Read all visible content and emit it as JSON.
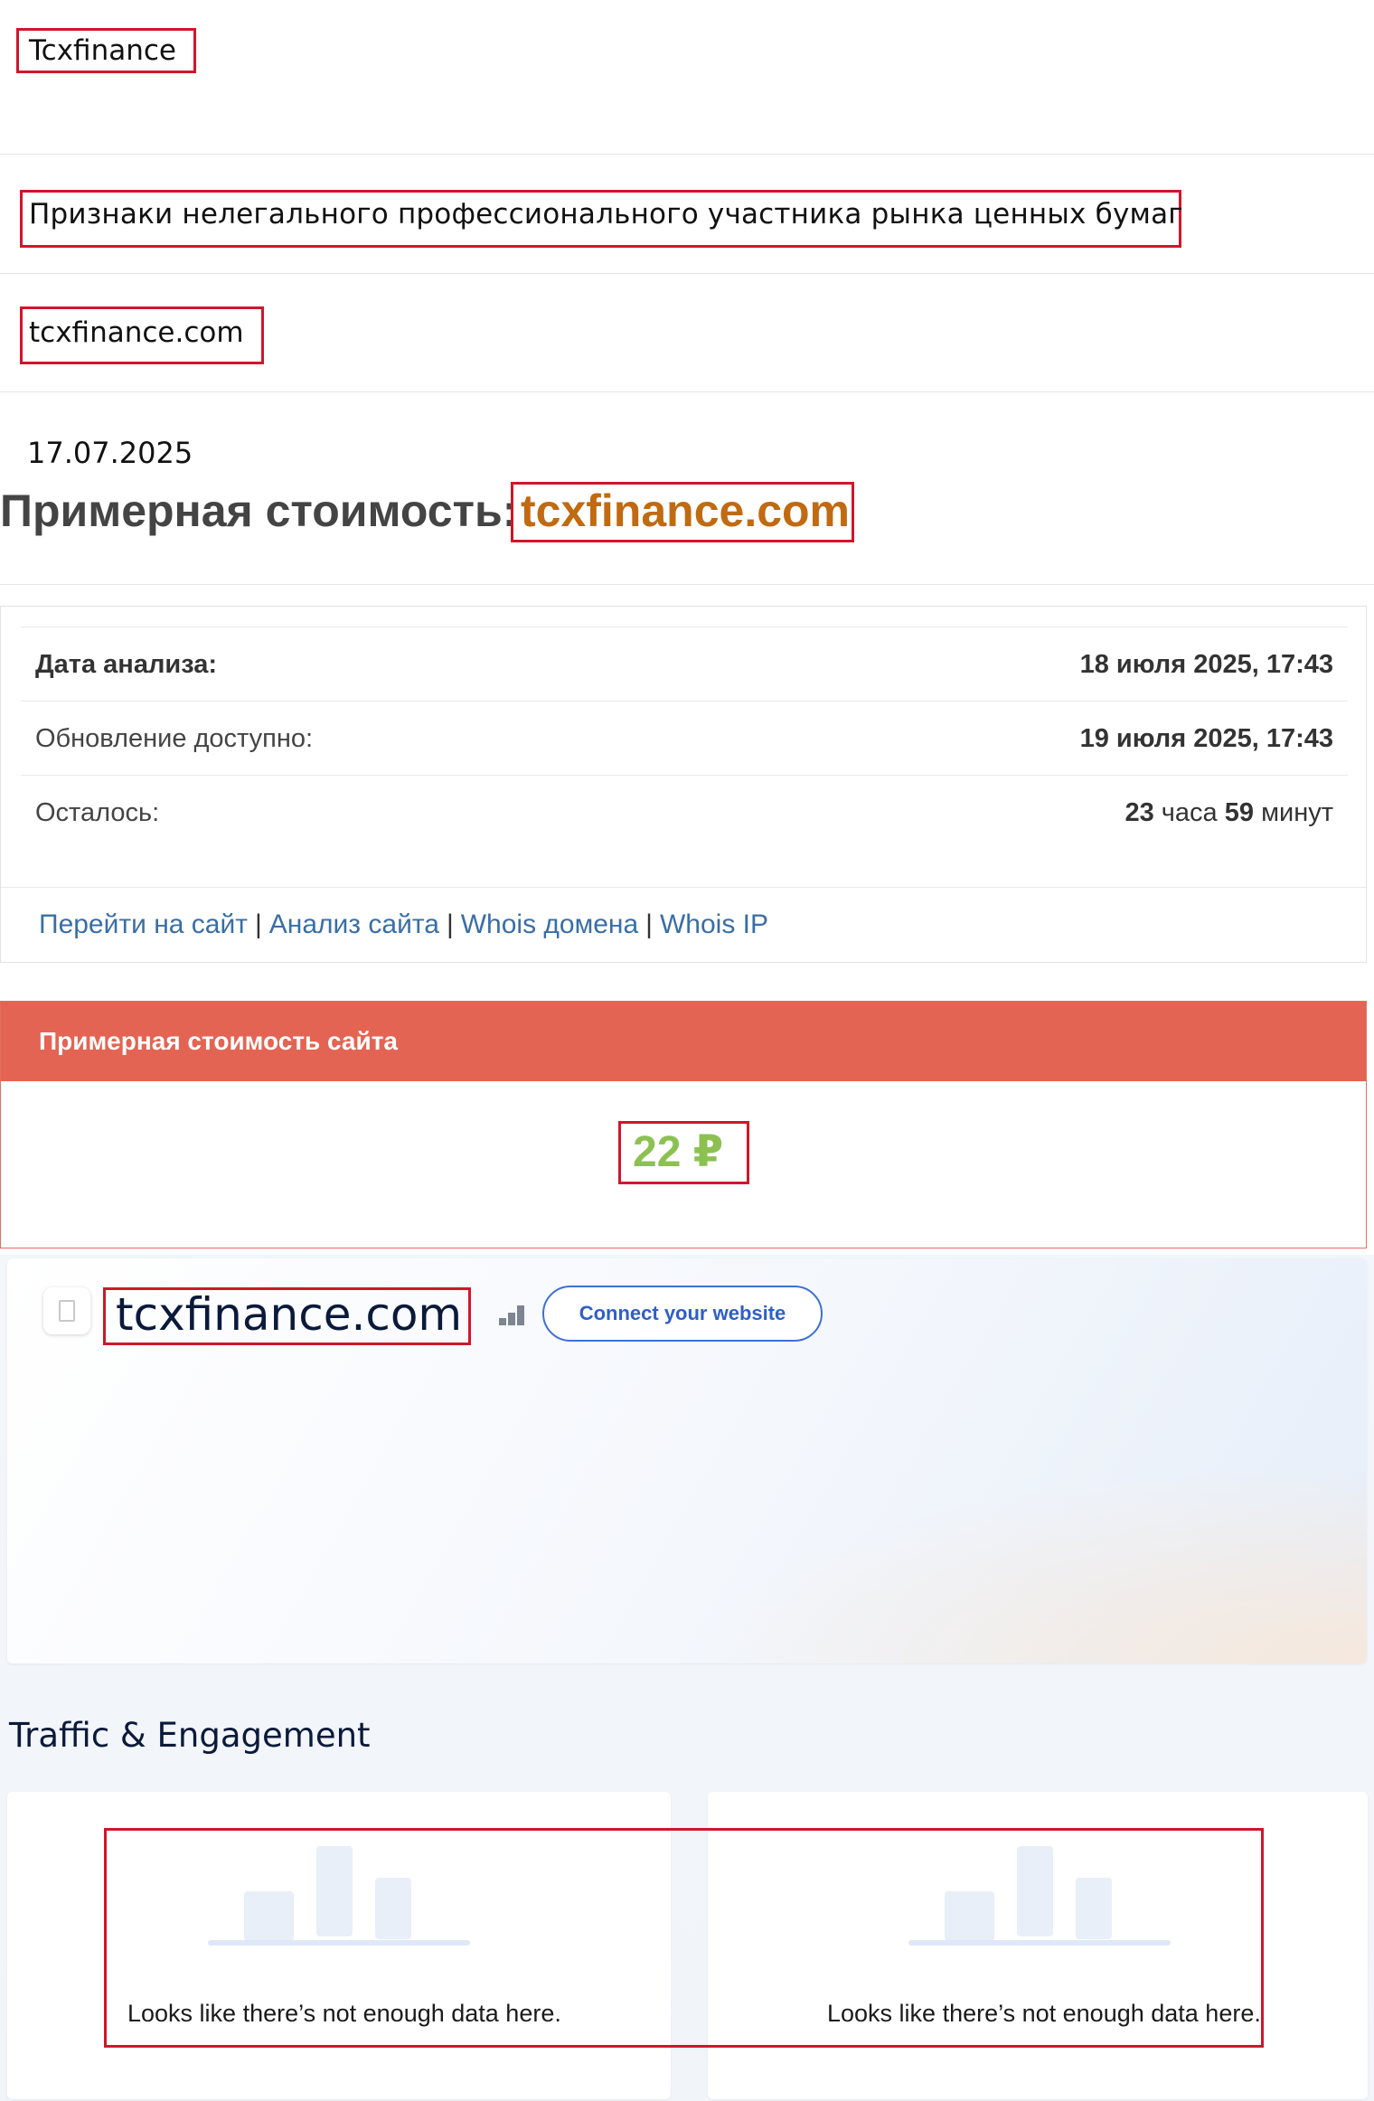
{
  "page": {
    "title": "Tcxfinance",
    "category": "Признаки нелегального профессионального участника рынка ценных бумаг",
    "domain": "tcxfinance.com",
    "date": "17.07.2025"
  },
  "cost_section": {
    "heading": "Примерная стоимость:",
    "domain": "tcxfinance.com"
  },
  "analysis": {
    "rows": [
      {
        "label": "Дата анализа:",
        "value": "18 июля 2025, 17:43"
      },
      {
        "label": "Обновление доступно:",
        "value": "19 июля 2025, 17:43"
      }
    ],
    "remaining_label": "Осталось:",
    "remaining": {
      "hours": "23",
      "hours_unit": "часа",
      "minutes": "59",
      "minutes_unit": "минут"
    },
    "links": [
      "Перейти на сайт",
      "Анализ сайта",
      "Whois домена",
      "Whois IP"
    ]
  },
  "price_card": {
    "header": "Примерная стоимость сайта",
    "value": "22 ₽"
  },
  "similarweb": {
    "domain": "tcxfinance.com",
    "connect_button": "Connect your website",
    "traffic_title": "Traffic & Engagement",
    "empty_messages": [
      "Looks like there’s not enough data here.",
      "Looks like there’s not enough data here."
    ]
  },
  "colors": {
    "highlight_box": "#d0162b",
    "cost_domain": "#c06a12",
    "price_header": "#e46453",
    "price_value": "#8cc152",
    "link": "#3a6ea5",
    "connect_button": "#3d6fd6"
  },
  "icons": [
    "document-icon",
    "rank-bars-icon",
    "empty-data-illustration"
  ]
}
